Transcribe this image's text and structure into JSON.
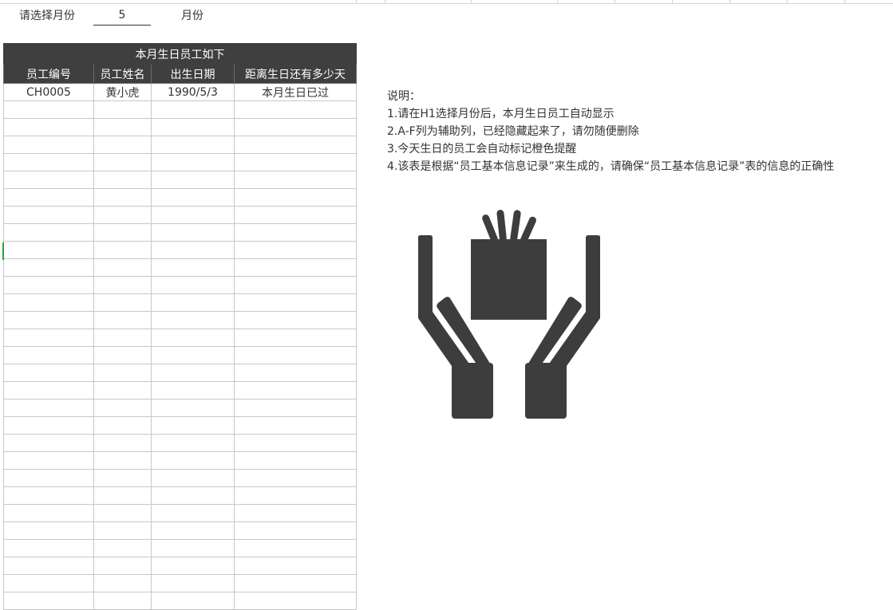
{
  "selector": {
    "label": "请选择月份",
    "value": "5",
    "unit": "月份"
  },
  "table": {
    "title": "本月生日员工如下",
    "columns": [
      "员工编号",
      "员工姓名",
      "出生日期",
      "距离生日还有多少天"
    ],
    "rows": [
      [
        "CH0005",
        "黄小虎",
        "1990/5/3",
        "本月生日已过"
      ]
    ],
    "empty_rows": 29
  },
  "notes": {
    "heading": "说明：",
    "items": [
      "1.请在H1选择月份后，本月生日员工自动显示",
      "2.A-F列为辅助列，已经隐藏起来了，请勿随便删除",
      "3.今天生日的员工会自动标记橙色提醒",
      "4.该表是根据“员工基本信息记录”来生成的，请确保“员工基本信息记录”表的信息的正确性"
    ]
  },
  "illustration": {
    "icon": "hands-gift-icon",
    "color": "#3d3d3d"
  },
  "colors": {
    "header_bg": "#3f3f3f",
    "header_text": "#ffffff",
    "grid": "#c8c8c8",
    "active_cell_marker": "#2e9e3b"
  }
}
